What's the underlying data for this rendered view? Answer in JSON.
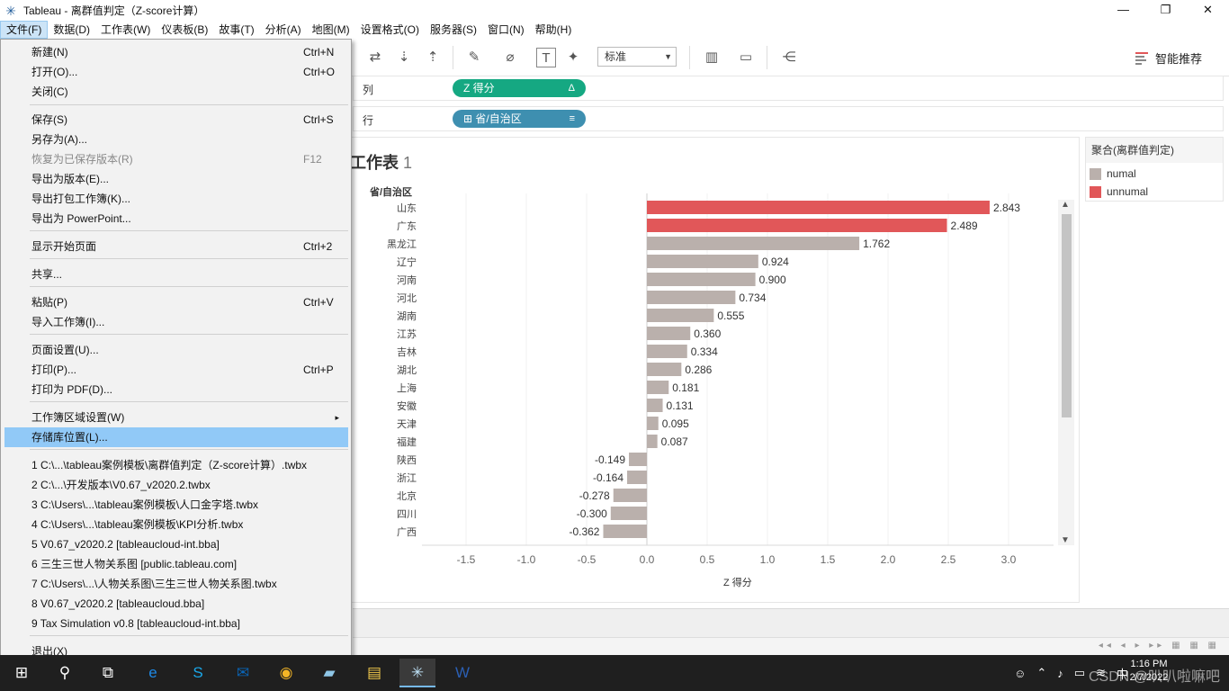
{
  "window": {
    "title": "Tableau - 离群值判定（Z-score计算）",
    "minimize": "—",
    "maximize": "❐",
    "close": "✕"
  },
  "menubar": {
    "items": [
      "文件(F)",
      "数据(D)",
      "工作表(W)",
      "仪表板(B)",
      "故事(T)",
      "分析(A)",
      "地图(M)",
      "设置格式(O)",
      "服务器(S)",
      "窗口(N)",
      "帮助(H)"
    ]
  },
  "toolbar": {
    "fit_value": "标准",
    "smart_recommend": "智能推荐"
  },
  "shelves": {
    "columns_label": "列",
    "rows_label": "行",
    "columns_pill": "Z 得分",
    "columns_pill_glyph": "Δ",
    "rows_pill": "⊞ 省/自治区",
    "rows_pill_glyph": "≡"
  },
  "sheet": {
    "title": "工作表",
    "title_num": "1",
    "row_header": "省/自治区",
    "x_axis_title": "Z 得分"
  },
  "legend": {
    "title": "聚合(离群值判定)",
    "items": [
      {
        "label": "numal",
        "color": "#bab0ac"
      },
      {
        "label": "unnumal",
        "color": "#e15759"
      }
    ]
  },
  "chart_data": {
    "type": "bar",
    "orientation": "horizontal",
    "categories": [
      "山东",
      "广东",
      "黑龙江",
      "辽宁",
      "河南",
      "河北",
      "湖南",
      "江苏",
      "吉林",
      "湖北",
      "上海",
      "安徽",
      "天津",
      "福建",
      "陕西",
      "浙江",
      "北京",
      "四川",
      "广西"
    ],
    "values": [
      2.843,
      2.489,
      1.762,
      0.924,
      0.9,
      0.734,
      0.555,
      0.36,
      0.334,
      0.286,
      0.181,
      0.131,
      0.095,
      0.087,
      -0.149,
      -0.164,
      -0.278,
      -0.3,
      -0.362
    ],
    "labels": [
      "2.843",
      "2.489",
      "1.762",
      "0.924",
      "0.900",
      "0.734",
      "0.555",
      "0.360",
      "0.334",
      "0.286",
      "0.181",
      "0.131",
      "0.095",
      "0.087",
      "-0.149",
      "-0.164",
      "-0.278",
      "-0.300",
      "-0.362"
    ],
    "groups": [
      "unnumal",
      "unnumal",
      "numal",
      "numal",
      "numal",
      "numal",
      "numal",
      "numal",
      "numal",
      "numal",
      "numal",
      "numal",
      "numal",
      "numal",
      "numal",
      "numal",
      "numal",
      "numal",
      "numal"
    ],
    "xlabel": "Z 得分",
    "ylabel": "省/自治区",
    "xlim": [
      -1.5,
      3.0
    ],
    "x_ticks": [
      "-1.5",
      "-1.0",
      "-0.5",
      "0.0",
      "0.5",
      "1.0",
      "1.5",
      "2.0",
      "2.5",
      "3.0"
    ],
    "grid": "vertical"
  },
  "file_menu": {
    "items": [
      {
        "label": "新建(N)",
        "shortcut": "Ctrl+N"
      },
      {
        "label": "打开(O)...",
        "shortcut": "Ctrl+O"
      },
      {
        "label": "关闭(C)",
        "shortcut": ""
      },
      {
        "label": "保存(S)",
        "shortcut": "Ctrl+S"
      },
      {
        "label": "另存为(A)...",
        "shortcut": ""
      },
      {
        "label": "恢复为已保存版本(R)",
        "shortcut": "F12"
      },
      {
        "label": "导出为版本(E)...",
        "shortcut": ""
      },
      {
        "label": "导出打包工作簿(K)...",
        "shortcut": ""
      },
      {
        "label": "导出为 PowerPoint...",
        "shortcut": ""
      },
      {
        "label": "显示开始页面",
        "shortcut": "Ctrl+2"
      },
      {
        "label": "共享...",
        "shortcut": ""
      },
      {
        "label": "粘贴(P)",
        "shortcut": "Ctrl+V"
      },
      {
        "label": "导入工作簿(I)...",
        "shortcut": ""
      },
      {
        "label": "页面设置(U)...",
        "shortcut": ""
      },
      {
        "label": "打印(P)...",
        "shortcut": "Ctrl+P"
      },
      {
        "label": "打印为 PDF(D)...",
        "shortcut": ""
      },
      {
        "label": "工作簿区域设置(W)",
        "shortcut": ""
      },
      {
        "label": "存储库位置(L)...",
        "shortcut": ""
      },
      {
        "label": "1 C:\\...\\tableau案例模板\\离群值判定（Z-score计算）.twbx",
        "shortcut": ""
      },
      {
        "label": "2 C:\\...\\开发版本\\V0.67_v2020.2.twbx",
        "shortcut": ""
      },
      {
        "label": "3 C:\\Users\\...\\tableau案例模板\\人口金字塔.twbx",
        "shortcut": ""
      },
      {
        "label": "4 C:\\Users\\...\\tableau案例模板\\KPI分析.twbx",
        "shortcut": ""
      },
      {
        "label": "5 V0.67_v2020.2 [tableaucloud-int.bba]",
        "shortcut": ""
      },
      {
        "label": "6 三生三世人物关系图 [public.tableau.com]",
        "shortcut": ""
      },
      {
        "label": "7 C:\\Users\\...\\人物关系图\\三生三世人物关系图.twbx",
        "shortcut": ""
      },
      {
        "label": "8 V0.67_v2020.2 [tableaucloud.bba]",
        "shortcut": ""
      },
      {
        "label": "9 Tax Simulation v0.8 [tableaucloud-int.bba]",
        "shortcut": ""
      },
      {
        "label": "退出(X)",
        "shortcut": ""
      }
    ],
    "submenu_arrow": "▸"
  },
  "taskbar": {
    "time": "1:16 PM",
    "date": "2/7/2022",
    "ime": "中",
    "watermark": "CSDN @叭叭啦嘛吧"
  }
}
